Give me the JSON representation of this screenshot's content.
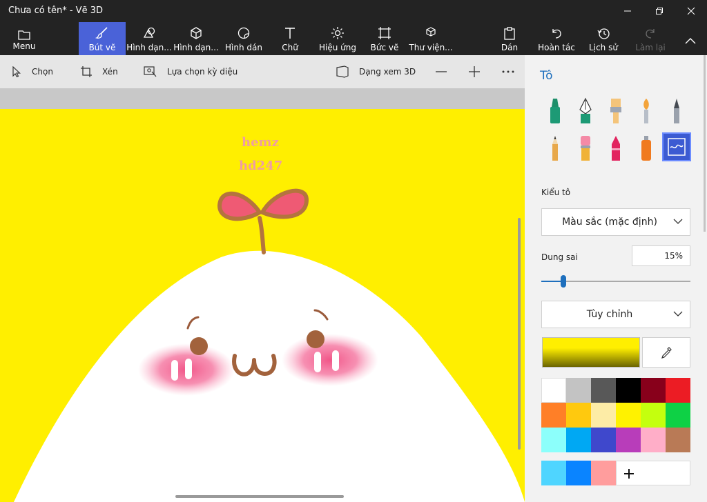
{
  "window": {
    "title": "Chưa có tên* - Vẽ 3D"
  },
  "ribbon": {
    "menu": "Menu",
    "brushes": "Bút vẽ",
    "shapes2d": "Hình dạn...",
    "shapes3d": "Hình dạn...",
    "stickers": "Hình dán",
    "text": "Chữ",
    "effects": "Hiệu ứng",
    "canvas": "Bức vẽ",
    "library": "Thư viện...",
    "paste": "Dán",
    "undo": "Hoàn tác",
    "history": "Lịch sử",
    "redo": "Làm lại"
  },
  "toolbar": {
    "select": "Chọn",
    "crop": "Xén",
    "magic_select": "Lựa chọn kỳ diệu",
    "view3d": "Dạng xem 3D"
  },
  "canvas": {
    "watermark_line1": "hemz",
    "watermark_line2": "hd247",
    "background_color": "#ffef00"
  },
  "panel": {
    "title": "Tô",
    "fill_type_label": "Kiểu tô",
    "fill_type_value": "Màu sắc (mặc định)",
    "tolerance_label": "Dung sai",
    "tolerance_value": "15%",
    "tolerance_fraction": 0.15,
    "custom_label": "Tùy chỉnh",
    "current_color": "#ffef00",
    "accent_color": "#1e6fbd"
  },
  "palette": [
    "#ffffff",
    "#c3c3c3",
    "#585858",
    "#000000",
    "#88001b",
    "#ec1c24",
    "#ff7f27",
    "#ffc90e",
    "#fdeca6",
    "#fff200",
    "#c4ff0e",
    "#0ed145",
    "#8cfffb",
    "#00a8f3",
    "#3f48cc",
    "#b83dba",
    "#ffaec8",
    "#b97a56",
    "#4fd5ff",
    "#0a84ff",
    "#ff9d9d"
  ]
}
